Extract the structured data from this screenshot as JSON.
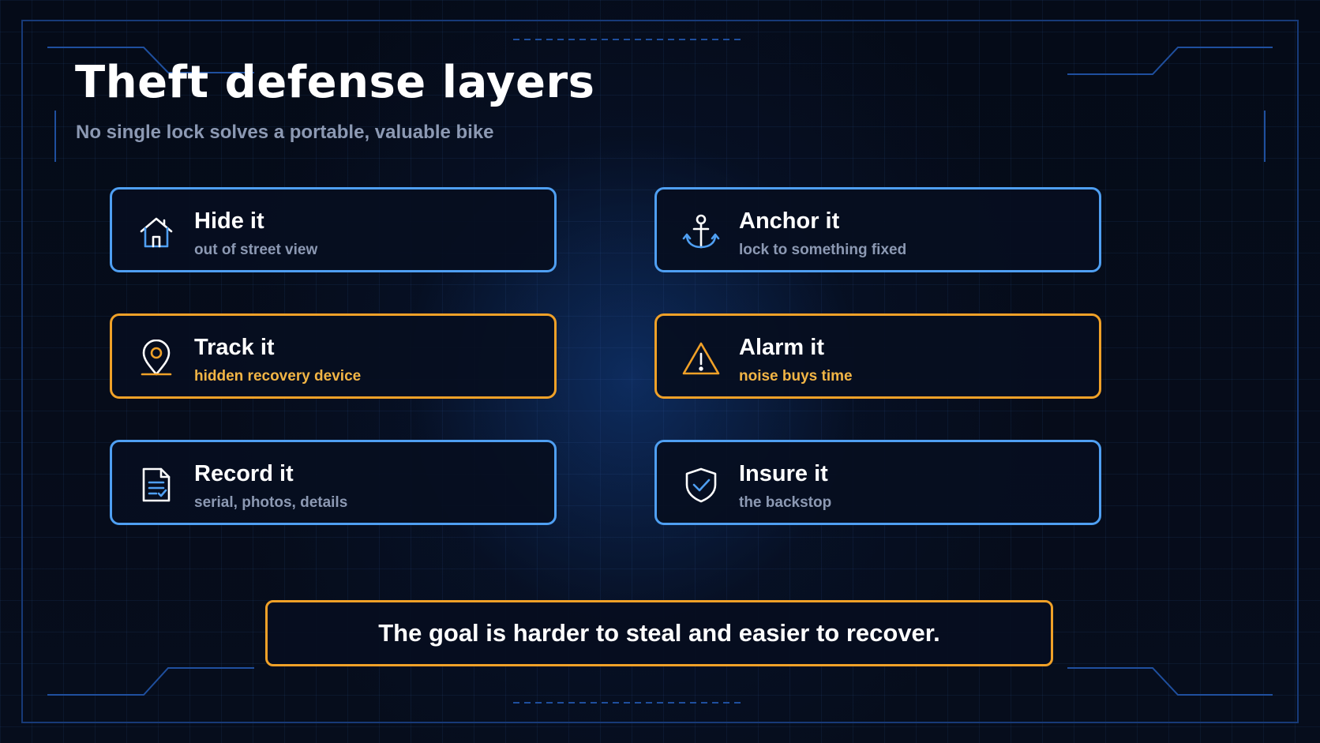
{
  "slide": {
    "title": "Theft defense layers",
    "subtitle": "No single lock solves a portable, valuable bike",
    "footer": "The goal is harder to steal and easier to recover."
  },
  "cards": [
    {
      "label": "Hide it",
      "desc": "out of street view",
      "icon": "house-icon",
      "accent": "#4f9ff2"
    },
    {
      "label": "Anchor it",
      "desc": "lock to something fixed",
      "icon": "anchor-icon",
      "accent": "#4f9ff2"
    },
    {
      "label": "Track it",
      "desc": "hidden recovery device",
      "icon": "location-pin-icon",
      "accent": "#f0a128"
    },
    {
      "label": "Alarm it",
      "desc": "noise buys time",
      "icon": "warning-triangle-icon",
      "accent": "#f0a128"
    },
    {
      "label": "Record it",
      "desc": "serial, photos, details",
      "icon": "document-icon",
      "accent": "#4f9ff2"
    },
    {
      "label": "Insure it",
      "desc": "the backstop",
      "icon": "shield-check-icon",
      "accent": "#4f9ff2"
    }
  ],
  "colors": {
    "background": "#050b18",
    "blue_accent": "#4f9ff2",
    "orange_accent": "#f0a128",
    "subtitle_gray": "#8c99b3",
    "orange_text": "#f2b545"
  }
}
